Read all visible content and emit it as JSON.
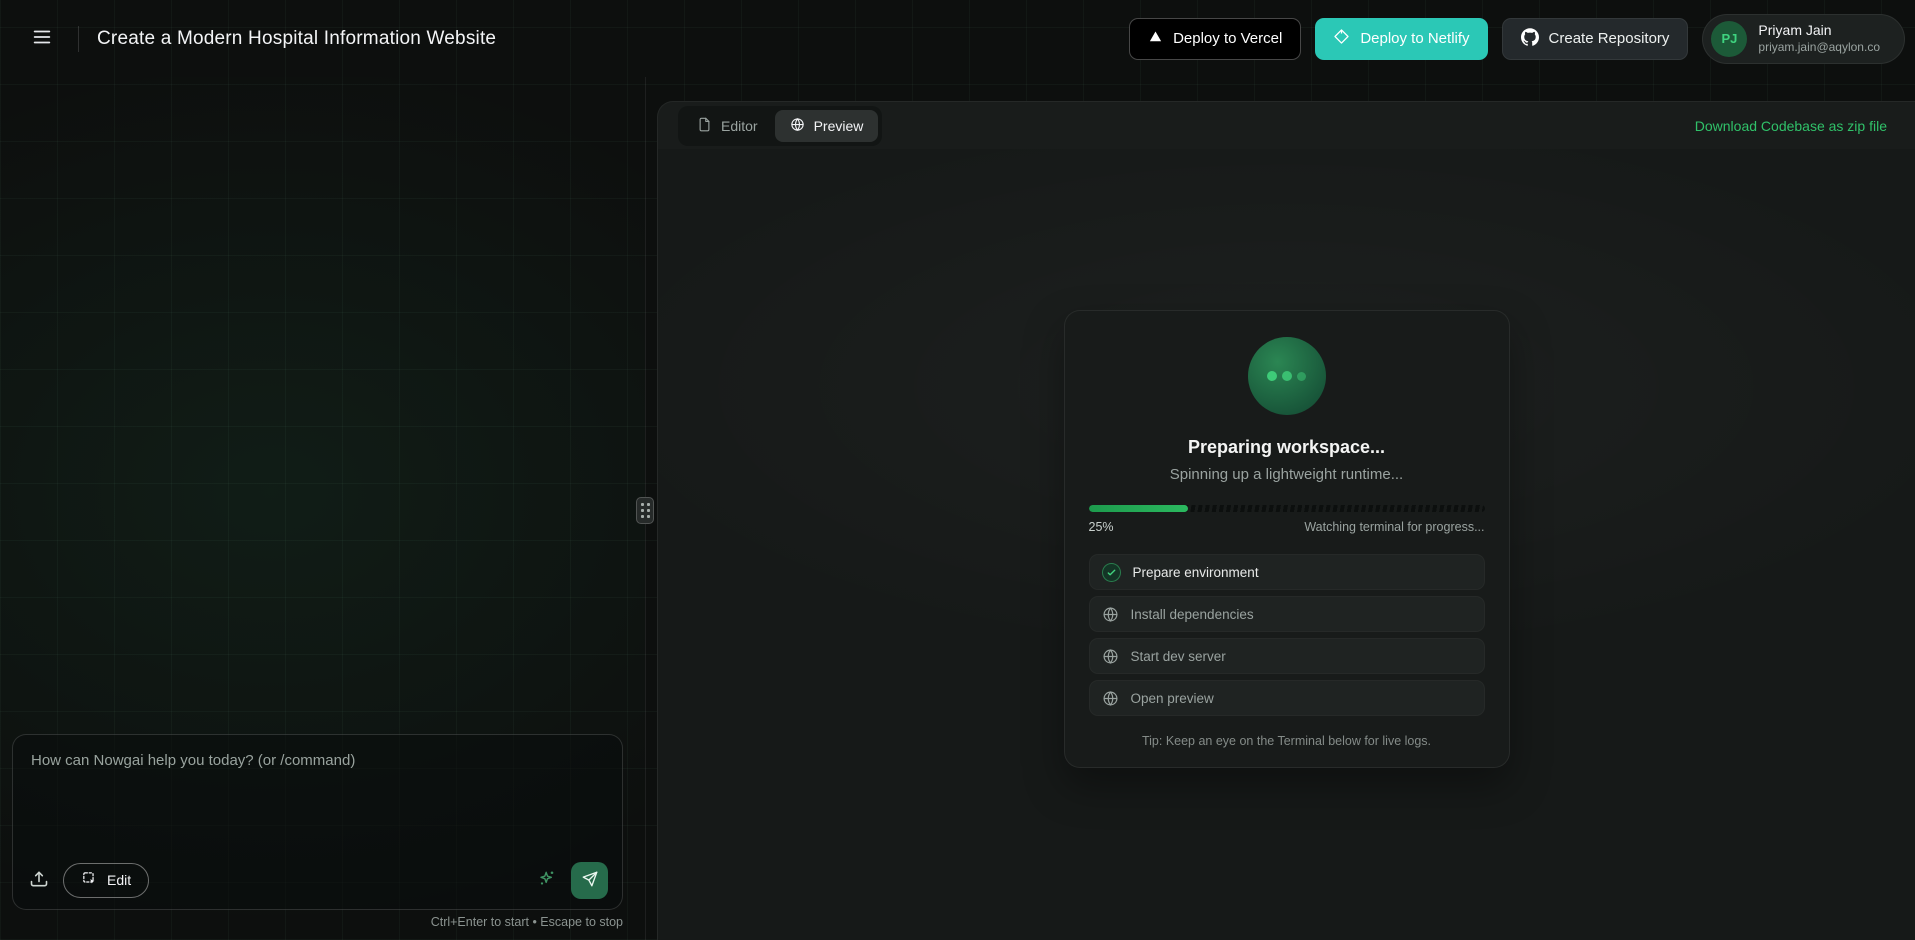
{
  "header": {
    "menu_icon": "hamburger-menu-icon",
    "title": "Create a Modern Hospital Information Website",
    "buttons": {
      "vercel": {
        "label": "Deploy to Vercel",
        "icon": "vercel-triangle-icon"
      },
      "netlify": {
        "label": "Deploy to Netlify",
        "icon": "netlify-diamond-icon"
      },
      "repo": {
        "label": "Create Repository",
        "icon": "github-icon"
      }
    },
    "user": {
      "initials": "PJ",
      "name": "Priyam Jain",
      "email": "priyam.jain@aqylon.co"
    }
  },
  "workspace": {
    "tabs": [
      {
        "label": "Editor",
        "icon": "file-icon",
        "active": false
      },
      {
        "label": "Preview",
        "icon": "globe-icon",
        "active": true
      }
    ],
    "download_link_label": "Download Codebase as zip file",
    "status_card": {
      "title": "Preparing workspace...",
      "subtitle": "Spinning up a lightweight runtime...",
      "progress_percent": 25,
      "progress_label": "25%",
      "progress_status": "Watching terminal for progress...",
      "steps": [
        {
          "label": "Prepare environment",
          "state": "done",
          "icon": "check-circle-icon"
        },
        {
          "label": "Install dependencies",
          "state": "pending",
          "icon": "globe-icon"
        },
        {
          "label": "Start dev server",
          "state": "pending",
          "icon": "globe-icon"
        },
        {
          "label": "Open preview",
          "state": "pending",
          "icon": "globe-icon"
        }
      ],
      "tip": "Tip: Keep an eye on the Terminal below for live logs."
    }
  },
  "chat": {
    "input_placeholder": "How can Nowgai help you today? (or /command)",
    "input_value": "",
    "upload_icon": "upload-icon",
    "edit_button": {
      "label": "Edit",
      "icon": "box-select-cursor-icon"
    },
    "sparkles_icon": "sparkles-icon",
    "send_icon": "send-plane-icon",
    "shortcut_hint": "Ctrl+Enter to start • Escape to stop"
  },
  "colors": {
    "page_bg": "#0d0f0e",
    "panel_bg": "#191c1b",
    "card_bg": "#181b1a",
    "netlify_teal": "#2bc8b6",
    "vercel_black": "#000000",
    "download_link_green": "#30c169",
    "progress_fill_green": "#24a956",
    "orb_green": "#1f6f45",
    "send_button_green": "#266b4b",
    "avatar_bg_green": "#1c5a38",
    "avatar_text_green": "#3fd37f"
  }
}
